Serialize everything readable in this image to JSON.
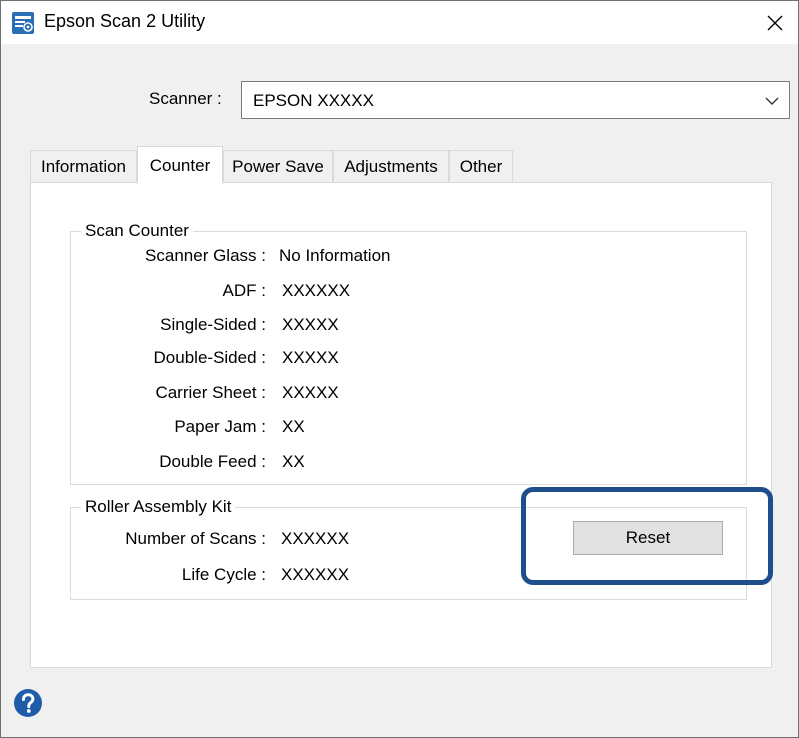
{
  "window": {
    "title": "Epson Scan 2 Utility",
    "close_glyph": "×"
  },
  "scanner": {
    "label": "Scanner :",
    "selected": "EPSON XXXXX"
  },
  "tabs": [
    {
      "label": "Information",
      "active": false
    },
    {
      "label": "Counter",
      "active": true
    },
    {
      "label": "Power Save",
      "active": false
    },
    {
      "label": "Adjustments",
      "active": false
    },
    {
      "label": "Other",
      "active": false
    }
  ],
  "scan_counter": {
    "title": "Scan Counter",
    "rows": [
      {
        "label": "Scanner Glass :",
        "value": "No Information"
      },
      {
        "label": "ADF :",
        "value": "XXXXXX"
      },
      {
        "label": "Single-Sided :",
        "value": "XXXXX"
      },
      {
        "label": "Double-Sided :",
        "value": "XXXXX"
      },
      {
        "label": "Carrier Sheet :",
        "value": "XXXXX"
      },
      {
        "label": "Paper Jam :",
        "value": "XX"
      },
      {
        "label": "Double Feed :",
        "value": "XX"
      }
    ]
  },
  "roller_kit": {
    "title": "Roller Assembly Kit",
    "rows": [
      {
        "label": "Number of Scans :",
        "value": "XXXXXX"
      },
      {
        "label": "Life Cycle :",
        "value": "XXXXXX"
      }
    ],
    "reset_label": "Reset"
  },
  "colors": {
    "highlight": "#1e4f8c",
    "help_icon": "#1f5da8",
    "app_icon": "#2a6fb5"
  },
  "icons": {
    "app": "epson-scan-app-icon",
    "close": "close-icon",
    "dropdown": "chevron-down-icon",
    "help": "help-icon"
  }
}
